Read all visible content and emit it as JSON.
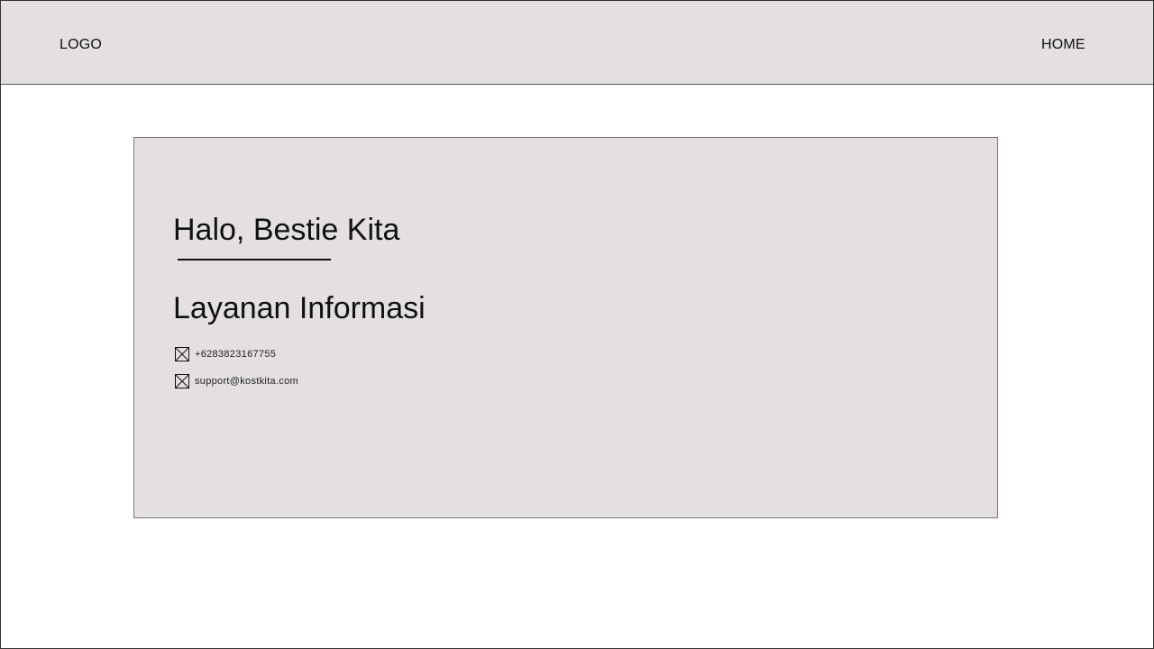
{
  "header": {
    "logo_text": "LOGO",
    "nav_home_label": "HOME"
  },
  "card": {
    "greeting": "Halo, Bestie Kita",
    "section_title": "Layanan Informasi",
    "contacts": [
      {
        "icon": "image-placeholder-icon",
        "text": "+6283823167755"
      },
      {
        "icon": "image-placeholder-icon",
        "text": "support@kostkita.com"
      }
    ]
  },
  "colors": {
    "panel_background": "#e4e0e0",
    "text": "#111111"
  }
}
